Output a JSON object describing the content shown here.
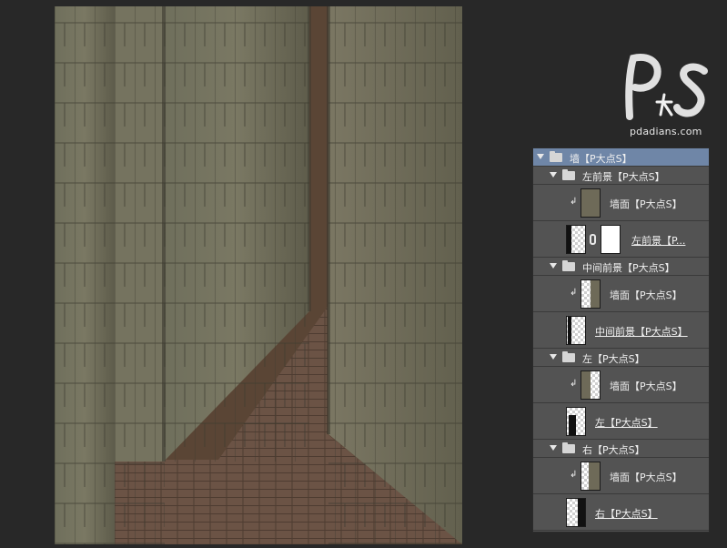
{
  "canvas": {
    "description_colors": {
      "wall": "#6b6b56",
      "wall_dark": "#3f3d32",
      "floor": "#6a5244",
      "sky": "#5a4535"
    }
  },
  "watermark": {
    "logo_text": "P大点S",
    "url": "pdadians.com"
  },
  "layers_panel": {
    "rows": [
      {
        "type": "group",
        "name": "墙【P大点S】",
        "indent": 0,
        "selected": true
      },
      {
        "type": "group",
        "name": "左前景【P大点S】",
        "indent": 1,
        "selected": false
      },
      {
        "type": "layer",
        "name": "墙面【P大点S】",
        "clipped": true,
        "thumb": "wall-full"
      },
      {
        "type": "layer",
        "name": "左前景【P...",
        "clipped": false,
        "thumb": "left-fg",
        "mask": true
      },
      {
        "type": "group",
        "name": "中间前景【P大点S】",
        "indent": 1,
        "selected": false
      },
      {
        "type": "layer",
        "name": "墙面【P大点S】",
        "clipped": true,
        "thumb": "wall-mid"
      },
      {
        "type": "layer",
        "name": "中间前景【P大点S】",
        "clipped": false,
        "thumb": "mid-fg"
      },
      {
        "type": "group",
        "name": "左【P大点S】",
        "indent": 1,
        "selected": false
      },
      {
        "type": "layer",
        "name": "墙面【P大点S】",
        "clipped": true,
        "thumb": "wall-left"
      },
      {
        "type": "layer",
        "name": "左【P大点S】",
        "clipped": false,
        "thumb": "left-shape"
      },
      {
        "type": "group",
        "name": "右【P大点S】",
        "indent": 1,
        "selected": false
      },
      {
        "type": "layer",
        "name": "墙面【P大点S】",
        "clipped": true,
        "thumb": "wall-right"
      },
      {
        "type": "layer",
        "name": "右【P大点S】",
        "clipped": false,
        "thumb": "right-shape"
      }
    ]
  }
}
